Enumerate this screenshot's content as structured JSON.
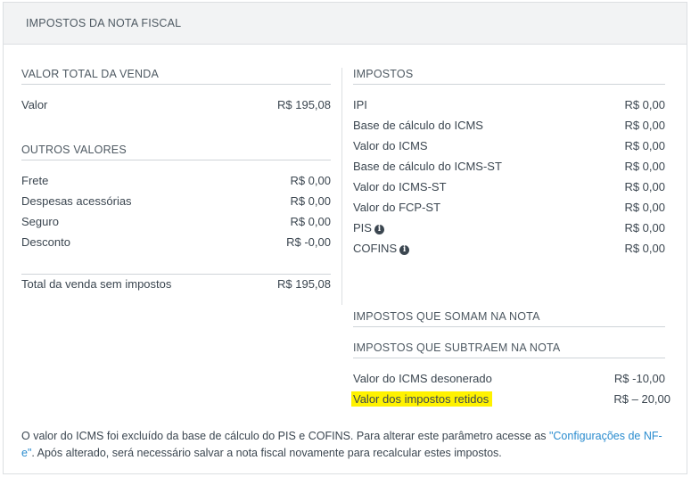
{
  "header": {
    "title": "IMPOSTOS DA NOTA FISCAL"
  },
  "venda": {
    "title": "VALOR TOTAL DA VENDA",
    "rows": [
      {
        "label": "Valor",
        "value": "R$ 195,08"
      }
    ]
  },
  "outros": {
    "title": "OUTROS VALORES",
    "rows": [
      {
        "label": "Frete",
        "value": "R$ 0,00"
      },
      {
        "label": "Despesas acessórias",
        "value": "R$ 0,00"
      },
      {
        "label": "Seguro",
        "value": "R$ 0,00"
      },
      {
        "label": "Desconto",
        "value": "R$ -0,00"
      }
    ]
  },
  "total_sem_impostos": {
    "label": "Total da venda sem impostos",
    "value": "R$ 195,08"
  },
  "impostos": {
    "title": "IMPOSTOS",
    "rows": [
      {
        "label": "IPI",
        "value": "R$ 0,00"
      },
      {
        "label": "Base de cálculo do ICMS",
        "value": "R$ 0,00"
      },
      {
        "label": "Valor do ICMS",
        "value": "R$ 0,00"
      },
      {
        "label": "Base de cálculo do ICMS-ST",
        "value": "R$ 0,00"
      },
      {
        "label": "Valor do ICMS-ST",
        "value": "R$ 0,00"
      },
      {
        "label": "Valor do FCP-ST",
        "value": "R$ 0,00"
      },
      {
        "label": "PIS",
        "value": "R$ 0,00",
        "icon": "info-icon"
      },
      {
        "label": "COFINS",
        "value": "R$ 0,00",
        "icon": "info-icon"
      }
    ]
  },
  "somam": {
    "title": "IMPOSTOS QUE SOMAM NA NOTA"
  },
  "subtraem": {
    "title": "IMPOSTOS QUE SUBTRAEM NA NOTA",
    "rows": [
      {
        "label": "Valor do ICMS desonerado",
        "value": "R$ -10,00"
      },
      {
        "label": "Valor dos impostos retidos",
        "value": "R$ – 20,00"
      }
    ]
  },
  "footer": {
    "text_before": "O valor do ICMS foi excluído da base de cálculo do PIS e COFINS. Para alterar este parâmetro acesse as ",
    "link": "\"Configurações de NF-e\"",
    "text_after": ". Após alterado, será necessário salvar a nota fiscal novamente para recalcular estes impostos."
  },
  "colors": {
    "highlight": "#fff200",
    "link": "#2a8ccf"
  }
}
